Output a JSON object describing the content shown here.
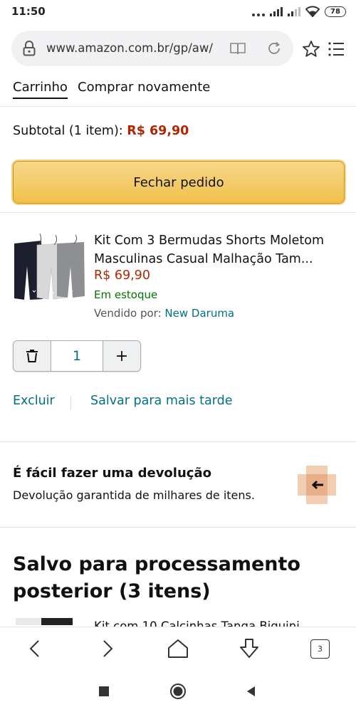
{
  "status_bar": {
    "time": "11:50",
    "battery": "78"
  },
  "browser": {
    "url": "www.amazon.com.br/gp/aw/",
    "tab_count": "3"
  },
  "tabs": {
    "cart": "Carrinho",
    "buy_again": "Comprar novamente"
  },
  "cart": {
    "subtotal_label": "Subtotal (1 item): ",
    "subtotal_value": "R$ 69,90",
    "checkout_label": "Fechar pedido"
  },
  "item": {
    "title": "Kit Com 3 Bermudas Shorts Moletom Masculinas Casual Malhação Tam...",
    "price": "R$ 69,90",
    "stock": "Em estoque",
    "sold_by_label": "Vendido por: ",
    "seller": "New Daruma",
    "quantity": "1",
    "increment": "+",
    "delete_label": "Excluir",
    "save_later_label": "Salvar para mais tarde"
  },
  "returns": {
    "title": "É fácil fazer uma devolução",
    "subtitle": "Devolução garantida de milhares de itens."
  },
  "saved": {
    "title": "Salvo para processamento posterior (3 itens)",
    "first_item_title": "Kit com 10 Calcinhas Tanga Biquini"
  },
  "colors": {
    "price": "#b12704",
    "link": "#007185",
    "stock": "#007600",
    "checkout": "#f0c14b"
  }
}
